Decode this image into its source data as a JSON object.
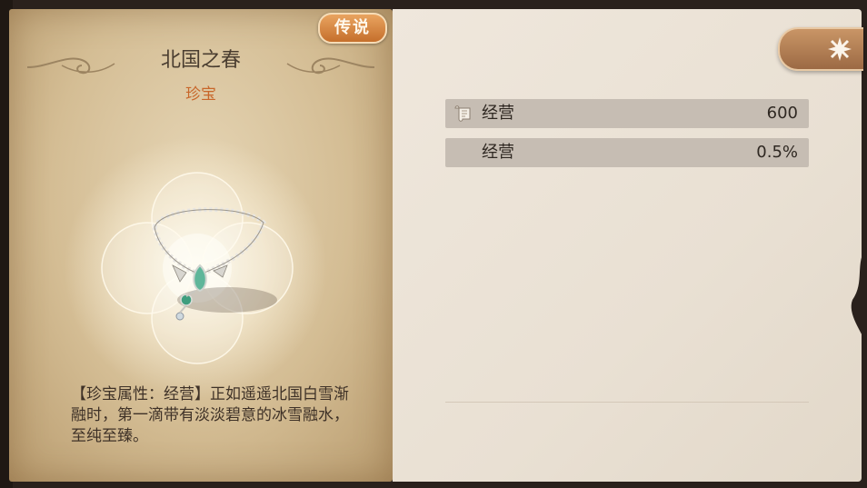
{
  "item": {
    "rarity": "传说",
    "name": "北国之春",
    "type": "珍宝",
    "description": "【珍宝属性：经营】正如遥遥北国白雪渐融时，第一滴带有淡淡碧意的冰雪融水，至纯至臻。"
  },
  "stats": [
    {
      "label": "经营",
      "value": "600",
      "icon": "scroll-icon"
    },
    {
      "label": "经营",
      "value": "0.5%",
      "icon": ""
    }
  ],
  "colors": {
    "rarity_badge": "#d98a47",
    "type_text": "#c8672b",
    "stat_row_bg": "#c6bdb3",
    "panel_bg": "#ece4d8"
  }
}
